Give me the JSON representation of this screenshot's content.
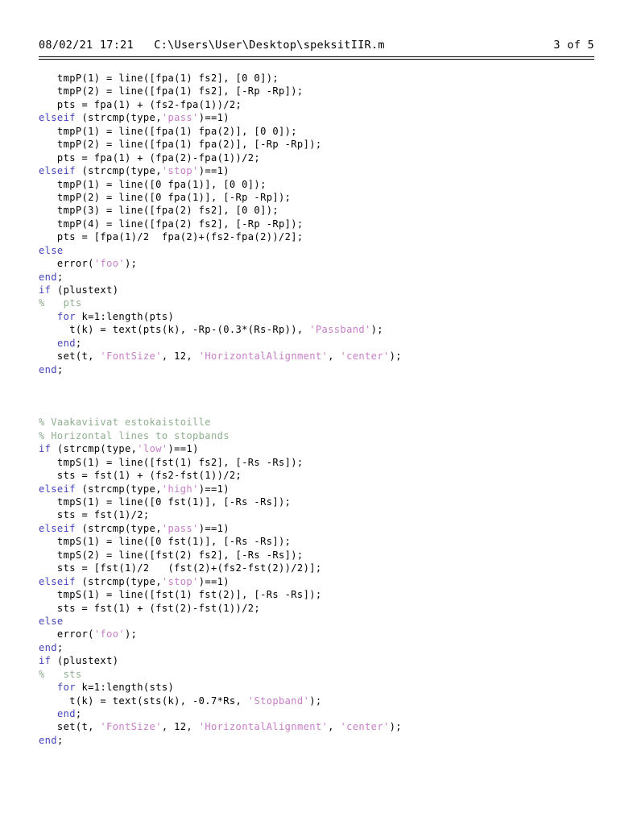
{
  "header": {
    "date": "08/02/21",
    "time": "17:21",
    "path": "C:\\Users\\User\\Desktop\\speksitIIR.m",
    "page_indicator": "3 of 5"
  },
  "colors": {
    "keyword": "#4444bb",
    "string": "#c77ec7",
    "comment": "#8fae8f",
    "plain": "#000000",
    "background": "#ffffff"
  },
  "document": {
    "language": "matlab",
    "filename": "speksitIIR.m"
  },
  "code_lines": [
    {
      "id": 0,
      "tokens": [
        {
          "t": "pln",
          "v": "   tmpP(1) = line([fpa(1) fs2], [0 0]);"
        }
      ]
    },
    {
      "id": 1,
      "tokens": [
        {
          "t": "pln",
          "v": "   tmpP(2) = line([fpa(1) fs2], [-Rp -Rp]);"
        }
      ]
    },
    {
      "id": 2,
      "tokens": [
        {
          "t": "pln",
          "v": "   pts = fpa(1) + (fs2-fpa(1))/2;"
        }
      ]
    },
    {
      "id": 3,
      "tokens": [
        {
          "t": "kw",
          "v": "elseif"
        },
        {
          "t": "pln",
          "v": " (strcmp(type,"
        },
        {
          "t": "str",
          "v": "'pass'"
        },
        {
          "t": "pln",
          "v": ")==1)"
        }
      ]
    },
    {
      "id": 4,
      "tokens": [
        {
          "t": "pln",
          "v": "   tmpP(1) = line([fpa(1) fpa(2)], [0 0]);"
        }
      ]
    },
    {
      "id": 5,
      "tokens": [
        {
          "t": "pln",
          "v": "   tmpP(2) = line([fpa(1) fpa(2)], [-Rp -Rp]);"
        }
      ]
    },
    {
      "id": 6,
      "tokens": [
        {
          "t": "pln",
          "v": "   pts = fpa(1) + (fpa(2)-fpa(1))/2;"
        }
      ]
    },
    {
      "id": 7,
      "tokens": [
        {
          "t": "kw",
          "v": "elseif"
        },
        {
          "t": "pln",
          "v": " (strcmp(type,"
        },
        {
          "t": "str",
          "v": "'stop'"
        },
        {
          "t": "pln",
          "v": ")==1)"
        }
      ]
    },
    {
      "id": 8,
      "tokens": [
        {
          "t": "pln",
          "v": "   tmpP(1) = line([0 fpa(1)], [0 0]);"
        }
      ]
    },
    {
      "id": 9,
      "tokens": [
        {
          "t": "pln",
          "v": "   tmpP(2) = line([0 fpa(1)], [-Rp -Rp]);"
        }
      ]
    },
    {
      "id": 10,
      "tokens": [
        {
          "t": "pln",
          "v": "   tmpP(3) = line([fpa(2) fs2], [0 0]);"
        }
      ]
    },
    {
      "id": 11,
      "tokens": [
        {
          "t": "pln",
          "v": "   tmpP(4) = line([fpa(2) fs2], [-Rp -Rp]);"
        }
      ]
    },
    {
      "id": 12,
      "tokens": [
        {
          "t": "pln",
          "v": "   pts = [fpa(1)/2  fpa(2)+(fs2-fpa(2))/2];"
        }
      ]
    },
    {
      "id": 13,
      "tokens": [
        {
          "t": "kw",
          "v": "else"
        }
      ]
    },
    {
      "id": 14,
      "tokens": [
        {
          "t": "pln",
          "v": "   error("
        },
        {
          "t": "str",
          "v": "'foo'"
        },
        {
          "t": "pln",
          "v": ");"
        }
      ]
    },
    {
      "id": 15,
      "tokens": [
        {
          "t": "kw",
          "v": "end"
        },
        {
          "t": "pln",
          "v": ";"
        }
      ]
    },
    {
      "id": 16,
      "tokens": [
        {
          "t": "kw",
          "v": "if"
        },
        {
          "t": "pln",
          "v": " (plustext)"
        }
      ]
    },
    {
      "id": 17,
      "tokens": [
        {
          "t": "cmt",
          "v": "%   pts"
        }
      ]
    },
    {
      "id": 18,
      "tokens": [
        {
          "t": "pln",
          "v": "   "
        },
        {
          "t": "kw",
          "v": "for"
        },
        {
          "t": "pln",
          "v": " k=1:length(pts)"
        }
      ]
    },
    {
      "id": 19,
      "tokens": [
        {
          "t": "pln",
          "v": "     t(k) = text(pts(k), -Rp-(0.3*(Rs-Rp)), "
        },
        {
          "t": "str",
          "v": "'Passband'"
        },
        {
          "t": "pln",
          "v": ");"
        }
      ]
    },
    {
      "id": 20,
      "tokens": [
        {
          "t": "pln",
          "v": "   "
        },
        {
          "t": "kw",
          "v": "end"
        },
        {
          "t": "pln",
          "v": ";"
        }
      ]
    },
    {
      "id": 21,
      "tokens": [
        {
          "t": "pln",
          "v": "   set(t, "
        },
        {
          "t": "str",
          "v": "'FontSize'"
        },
        {
          "t": "pln",
          "v": ", 12, "
        },
        {
          "t": "str",
          "v": "'HorizontalAlignment'"
        },
        {
          "t": "pln",
          "v": ", "
        },
        {
          "t": "str",
          "v": "'center'"
        },
        {
          "t": "pln",
          "v": ");"
        }
      ]
    },
    {
      "id": 22,
      "tokens": [
        {
          "t": "kw",
          "v": "end"
        },
        {
          "t": "pln",
          "v": ";"
        }
      ]
    },
    {
      "id": 23,
      "tokens": []
    },
    {
      "id": 24,
      "tokens": []
    },
    {
      "id": 25,
      "tokens": []
    },
    {
      "id": 26,
      "tokens": [
        {
          "t": "cmt",
          "v": "% Vaakaviivat estokaistoille"
        }
      ]
    },
    {
      "id": 27,
      "tokens": [
        {
          "t": "cmt",
          "v": "% Horizontal lines to stopbands"
        }
      ]
    },
    {
      "id": 28,
      "tokens": [
        {
          "t": "kw",
          "v": "if"
        },
        {
          "t": "pln",
          "v": " (strcmp(type,"
        },
        {
          "t": "str",
          "v": "'low'"
        },
        {
          "t": "pln",
          "v": ")==1)"
        }
      ]
    },
    {
      "id": 29,
      "tokens": [
        {
          "t": "pln",
          "v": "   tmpS(1) = line([fst(1) fs2], [-Rs -Rs]);"
        }
      ]
    },
    {
      "id": 30,
      "tokens": [
        {
          "t": "pln",
          "v": "   sts = fst(1) + (fs2-fst(1))/2;"
        }
      ]
    },
    {
      "id": 31,
      "tokens": [
        {
          "t": "kw",
          "v": "elseif"
        },
        {
          "t": "pln",
          "v": " (strcmp(type,"
        },
        {
          "t": "str",
          "v": "'high'"
        },
        {
          "t": "pln",
          "v": ")==1)"
        }
      ]
    },
    {
      "id": 32,
      "tokens": [
        {
          "t": "pln",
          "v": "   tmpS(1) = line([0 fst(1)], [-Rs -Rs]);"
        }
      ]
    },
    {
      "id": 33,
      "tokens": [
        {
          "t": "pln",
          "v": "   sts = fst(1)/2;"
        }
      ]
    },
    {
      "id": 34,
      "tokens": [
        {
          "t": "kw",
          "v": "elseif"
        },
        {
          "t": "pln",
          "v": " (strcmp(type,"
        },
        {
          "t": "str",
          "v": "'pass'"
        },
        {
          "t": "pln",
          "v": ")==1)"
        }
      ]
    },
    {
      "id": 35,
      "tokens": [
        {
          "t": "pln",
          "v": "   tmpS(1) = line([0 fst(1)], [-Rs -Rs]);"
        }
      ]
    },
    {
      "id": 36,
      "tokens": [
        {
          "t": "pln",
          "v": "   tmpS(2) = line([fst(2) fs2], [-Rs -Rs]);"
        }
      ]
    },
    {
      "id": 37,
      "tokens": [
        {
          "t": "pln",
          "v": "   sts = [fst(1)/2   (fst(2)+(fs2-fst(2))/2)];"
        }
      ]
    },
    {
      "id": 38,
      "tokens": [
        {
          "t": "kw",
          "v": "elseif"
        },
        {
          "t": "pln",
          "v": " (strcmp(type,"
        },
        {
          "t": "str",
          "v": "'stop'"
        },
        {
          "t": "pln",
          "v": ")==1)"
        }
      ]
    },
    {
      "id": 39,
      "tokens": [
        {
          "t": "pln",
          "v": "   tmpS(1) = line([fst(1) fst(2)], [-Rs -Rs]);"
        }
      ]
    },
    {
      "id": 40,
      "tokens": [
        {
          "t": "pln",
          "v": "   sts = fst(1) + (fst(2)-fst(1))/2;"
        }
      ]
    },
    {
      "id": 41,
      "tokens": [
        {
          "t": "kw",
          "v": "else"
        }
      ]
    },
    {
      "id": 42,
      "tokens": [
        {
          "t": "pln",
          "v": "   error("
        },
        {
          "t": "str",
          "v": "'foo'"
        },
        {
          "t": "pln",
          "v": ");"
        }
      ]
    },
    {
      "id": 43,
      "tokens": [
        {
          "t": "kw",
          "v": "end"
        },
        {
          "t": "pln",
          "v": ";"
        }
      ]
    },
    {
      "id": 44,
      "tokens": [
        {
          "t": "kw",
          "v": "if"
        },
        {
          "t": "pln",
          "v": " (plustext)"
        }
      ]
    },
    {
      "id": 45,
      "tokens": [
        {
          "t": "cmt",
          "v": "%   sts"
        }
      ]
    },
    {
      "id": 46,
      "tokens": [
        {
          "t": "pln",
          "v": "   "
        },
        {
          "t": "kw",
          "v": "for"
        },
        {
          "t": "pln",
          "v": " k=1:length(sts)"
        }
      ]
    },
    {
      "id": 47,
      "tokens": [
        {
          "t": "pln",
          "v": "     t(k) = text(sts(k), -0.7*Rs, "
        },
        {
          "t": "str",
          "v": "'Stopband'"
        },
        {
          "t": "pln",
          "v": ");"
        }
      ]
    },
    {
      "id": 48,
      "tokens": [
        {
          "t": "pln",
          "v": "   "
        },
        {
          "t": "kw",
          "v": "end"
        },
        {
          "t": "pln",
          "v": ";"
        }
      ]
    },
    {
      "id": 49,
      "tokens": [
        {
          "t": "pln",
          "v": "   set(t, "
        },
        {
          "t": "str",
          "v": "'FontSize'"
        },
        {
          "t": "pln",
          "v": ", 12, "
        },
        {
          "t": "str",
          "v": "'HorizontalAlignment'"
        },
        {
          "t": "pln",
          "v": ", "
        },
        {
          "t": "str",
          "v": "'center'"
        },
        {
          "t": "pln",
          "v": ");"
        }
      ]
    },
    {
      "id": 50,
      "tokens": [
        {
          "t": "kw",
          "v": "end"
        },
        {
          "t": "pln",
          "v": ";"
        }
      ]
    }
  ]
}
